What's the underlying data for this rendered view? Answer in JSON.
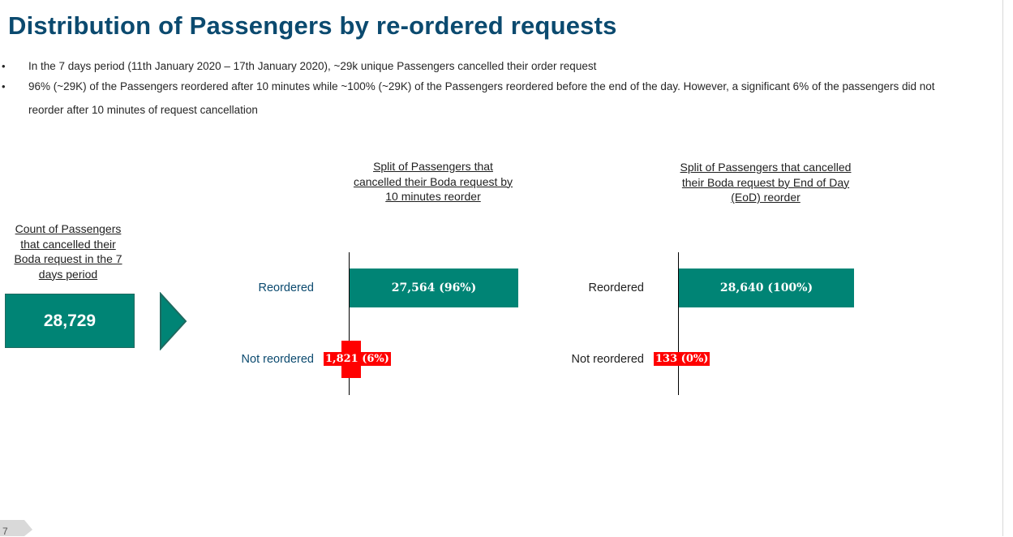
{
  "title": "Distribution of Passengers by re-ordered requests",
  "bullets": [
    "In the 7 days period (11th January 2020 –  17th January 2020),  ~29k unique Passengers cancelled their order request",
    "96% (~29K) of the Passengers reordered after 10 minutes while ~100% (~29K) of the Passengers reordered before the end of the day. However, a significant 6% of the passengers did not",
    "reorder after 10 minutes of request cancellation"
  ],
  "count_panel": {
    "header_lines": [
      "Count of Passengers",
      "that cancelled their",
      "Boda request in the 7",
      "days period"
    ],
    "value": "28,729"
  },
  "chart_data": [
    {
      "type": "bar",
      "orientation": "horizontal",
      "title_lines": [
        "Split of Passengers that",
        "cancelled their Boda request by",
        "10 minutes reorder"
      ],
      "categories": [
        "Reordered",
        "Not reordered"
      ],
      "values": [
        27564,
        1821
      ],
      "labels": [
        "27,564 (96%)",
        "1,821 (6%)"
      ],
      "colors": [
        "#008475",
        "#ff0000"
      ]
    },
    {
      "type": "bar",
      "orientation": "horizontal",
      "title_lines": [
        "Split of Passengers that cancelled",
        "their Boda request by End of Day",
        "(EoD)  reorder"
      ],
      "categories": [
        "Reordered",
        "Not reordered"
      ],
      "values": [
        28640,
        133
      ],
      "labels": [
        "28,640 (100%)",
        "133 (0%)"
      ],
      "colors": [
        "#008475",
        "#ff0000"
      ]
    }
  ],
  "page_number": "7",
  "icons": {
    "arrow": "chevron-right-arrow-icon",
    "bullet": "bullet-dot-icon"
  },
  "colors": {
    "title": "#0b4a6f",
    "teal": "#008475",
    "red": "#ff0000"
  }
}
